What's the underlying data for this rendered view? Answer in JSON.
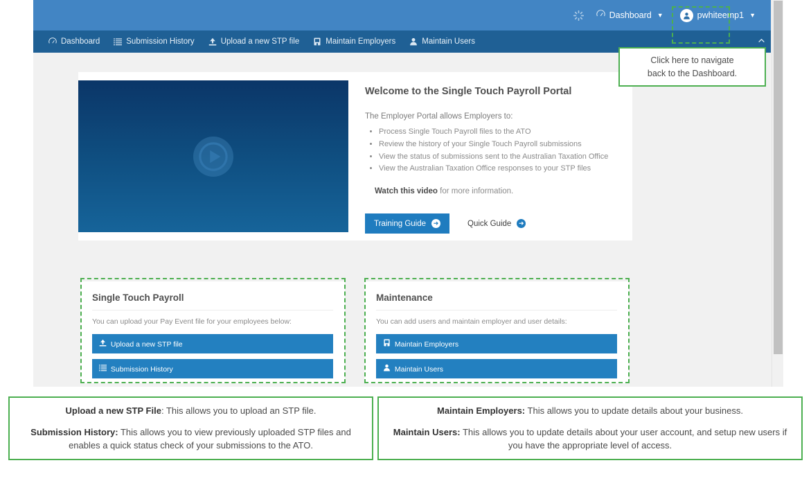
{
  "header": {
    "spinner_icon": "loading-spinner-icon",
    "dashboard_menu": {
      "label": "Dashboard",
      "icon": "gauge-icon",
      "caret": "▼"
    },
    "user_menu": {
      "label": "pwhiteemp1",
      "icon": "user-avatar-icon",
      "caret": "▼"
    }
  },
  "nav": {
    "items": [
      {
        "label": "Dashboard",
        "icon": "gauge-icon"
      },
      {
        "label": "Submission History",
        "icon": "list-icon"
      },
      {
        "label": "Upload a new STP file",
        "icon": "upload-icon"
      },
      {
        "label": "Maintain Employers",
        "icon": "building-icon"
      },
      {
        "label": "Maintain Users",
        "icon": "user-icon"
      }
    ],
    "collapse_icon": "chevron-up-icon"
  },
  "welcome": {
    "video": {
      "play_icon": "play-circle-icon"
    },
    "title": "Welcome to the Single Touch Payroll Portal",
    "lead": "The Employer Portal allows Employers to:",
    "bullets": [
      "Process Single Touch Payroll files to the ATO",
      "Review the history of your Single Touch Payroll submissions",
      "View the status of submissions sent to the Australian Taxation Office",
      "View the Australian Taxation Office responses to your STP files"
    ],
    "watch_bold": "Watch this video",
    "watch_rest": " for more information.",
    "training_guide_label": "Training Guide",
    "quick_guide_label": "Quick Guide",
    "arrow_glyph": "➜"
  },
  "panels": {
    "stp": {
      "title": "Single Touch Payroll",
      "subtitle": "You can upload your Pay Event file for your employees below:",
      "buttons": [
        {
          "label": "Upload a new STP file",
          "icon": "upload-icon"
        },
        {
          "label": "Submission History",
          "icon": "list-icon"
        }
      ]
    },
    "maintenance": {
      "title": "Maintenance",
      "subtitle": "You can add users and maintain employer and user details:",
      "buttons": [
        {
          "label": "Maintain Employers",
          "icon": "building-icon"
        },
        {
          "label": "Maintain Users",
          "icon": "user-icon"
        }
      ]
    }
  },
  "callouts": {
    "dashboard": {
      "line1": "Click here to navigate",
      "line2": "back to the Dashboard."
    },
    "left": {
      "p1_bold": "Upload a new STP File",
      "p1_rest": ": This allows you to upload an STP file.",
      "p2_bold": "Submission History:",
      "p2_rest": " This allows you to view previously uploaded STP files and enables a quick status check of your submissions to the ATO."
    },
    "right": {
      "p1_bold": "Maintain Employers:",
      "p1_rest": " This allows you to update details about your business.",
      "p2_bold": "Maintain Users:",
      "p2_rest": " This allows you to update details about your user account, and setup new users if you have the appropriate level of access."
    }
  },
  "colors": {
    "header_blue": "#4285c4",
    "nav_blue": "#1f6095",
    "button_blue": "#2380c0",
    "highlight_green": "#4caf50",
    "page_bg": "#f1f1f1"
  }
}
